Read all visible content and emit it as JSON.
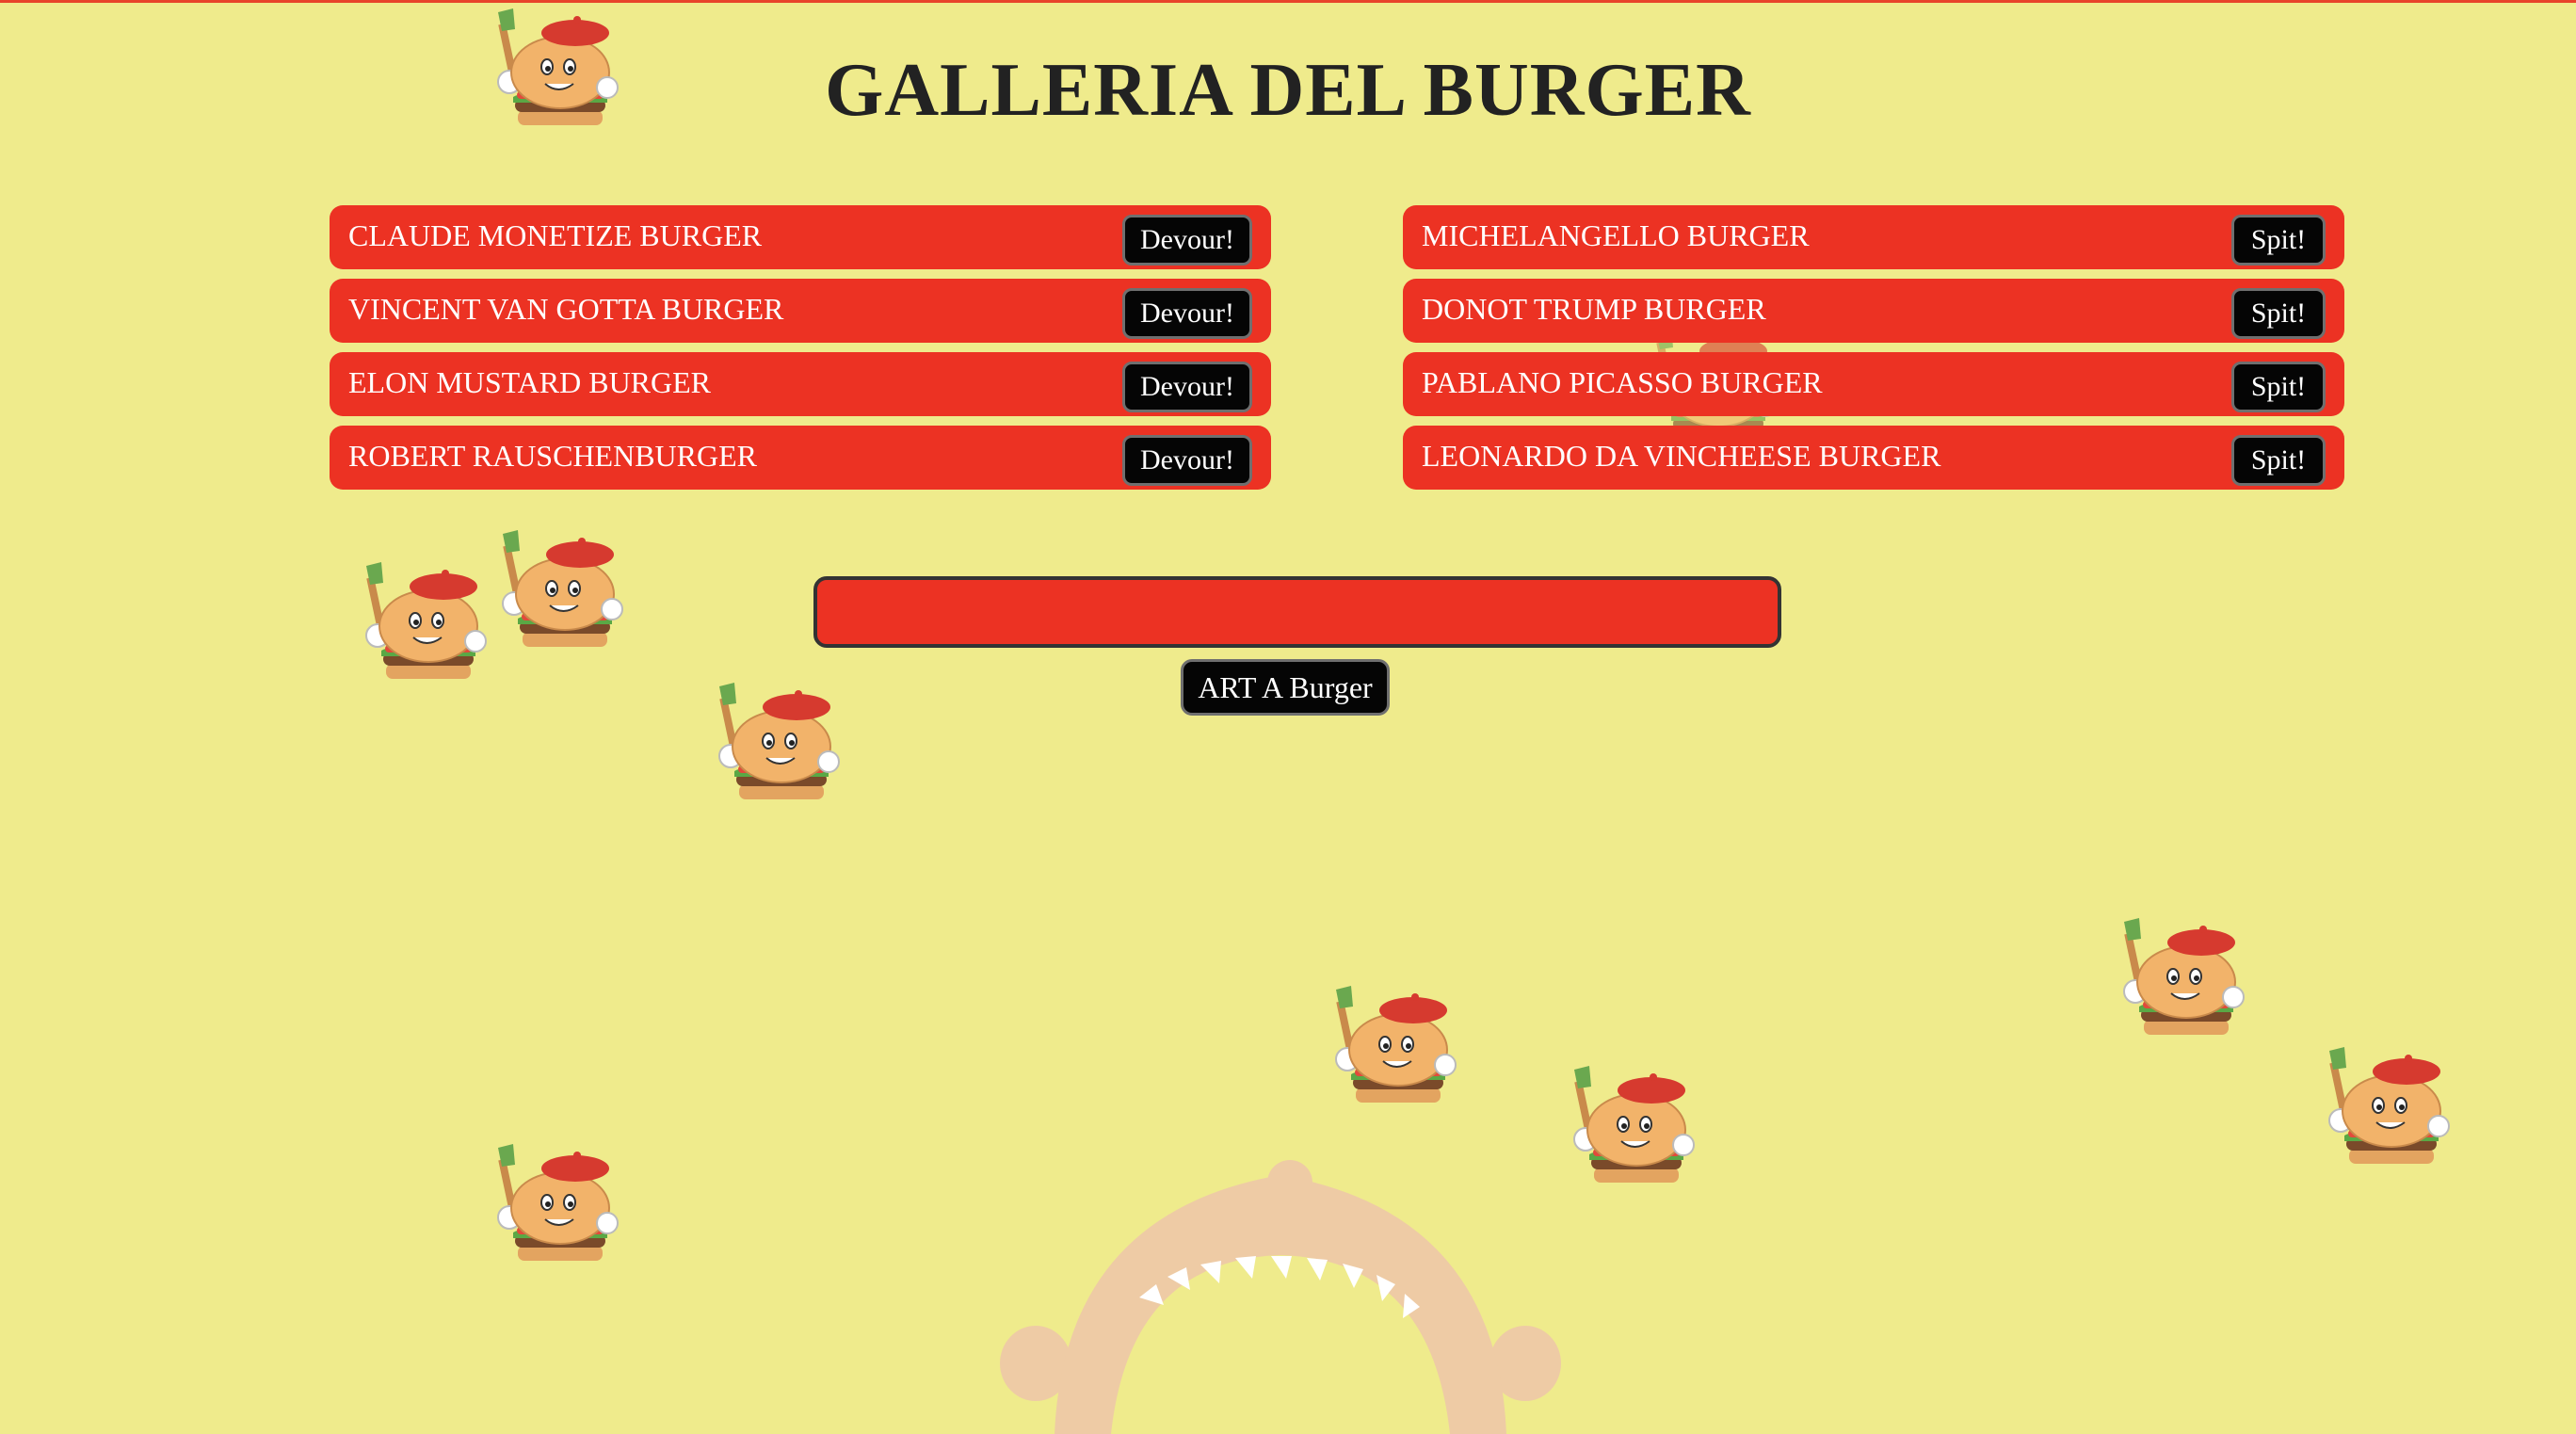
{
  "page": {
    "title": "GALLERIA DEL BURGER"
  },
  "uneaten_burgers": [
    {
      "name": "CLAUDE MONETIZE BURGER",
      "button": "Devour!"
    },
    {
      "name": "VINCENT VAN GOTTA BURGER",
      "button": "Devour!"
    },
    {
      "name": "ELON MUSTARD BURGER",
      "button": "Devour!"
    },
    {
      "name": "ROBERT RAUSCHENBURGER",
      "button": "Devour!"
    }
  ],
  "devoured_burgers": [
    {
      "name": "MICHELANGELLO BURGER",
      "button": "Spit!"
    },
    {
      "name": "DONOT TRUMP BURGER",
      "button": "Spit!"
    },
    {
      "name": "PABLANO PICASSO BURGER",
      "button": "Spit!"
    },
    {
      "name": "LEONARDO DA VINCHEESE BURGER",
      "button": "Spit!"
    }
  ],
  "form": {
    "input_value": "",
    "input_placeholder": "",
    "submit_label": "ART A Burger"
  },
  "decorations": {
    "mascot_icon": "artist-burger-mascot-icon",
    "mouth_icon": "open-mouth-icon"
  },
  "colors": {
    "background": "#efeb8c",
    "accent_red": "#ec3223",
    "button_black": "#050505"
  }
}
